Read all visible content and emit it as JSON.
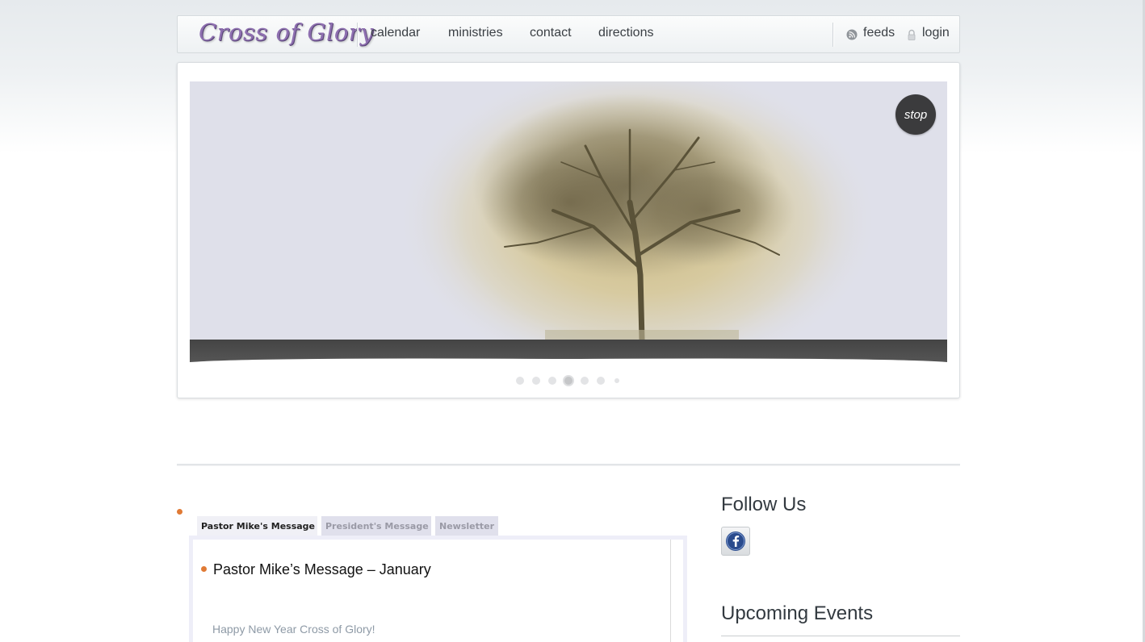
{
  "header": {
    "logo_text": "Cross of Glory",
    "nav": [
      "calendar",
      "ministries",
      "contact",
      "directions"
    ],
    "feeds_label": "feeds",
    "login_label": "login"
  },
  "slider": {
    "stop_label": "stop",
    "dot_count": 7,
    "active_dot": 4
  },
  "tabs": [
    "Pastor Mike's Message",
    "President's Message",
    "Newsletter"
  ],
  "post": {
    "title": "Pastor Mike’s Message – January",
    "excerpt": "Happy New Year Cross of Glory!"
  },
  "sidebar": {
    "follow_heading": "Follow Us",
    "events_heading": "Upcoming Events"
  },
  "colors": {
    "logo": "#8e6fb0",
    "bullet": "#e07a35",
    "slide_bg": "#dfe0ea",
    "tab_active": "#f0f0f6",
    "tab_inactive": "#e0e0ec"
  }
}
